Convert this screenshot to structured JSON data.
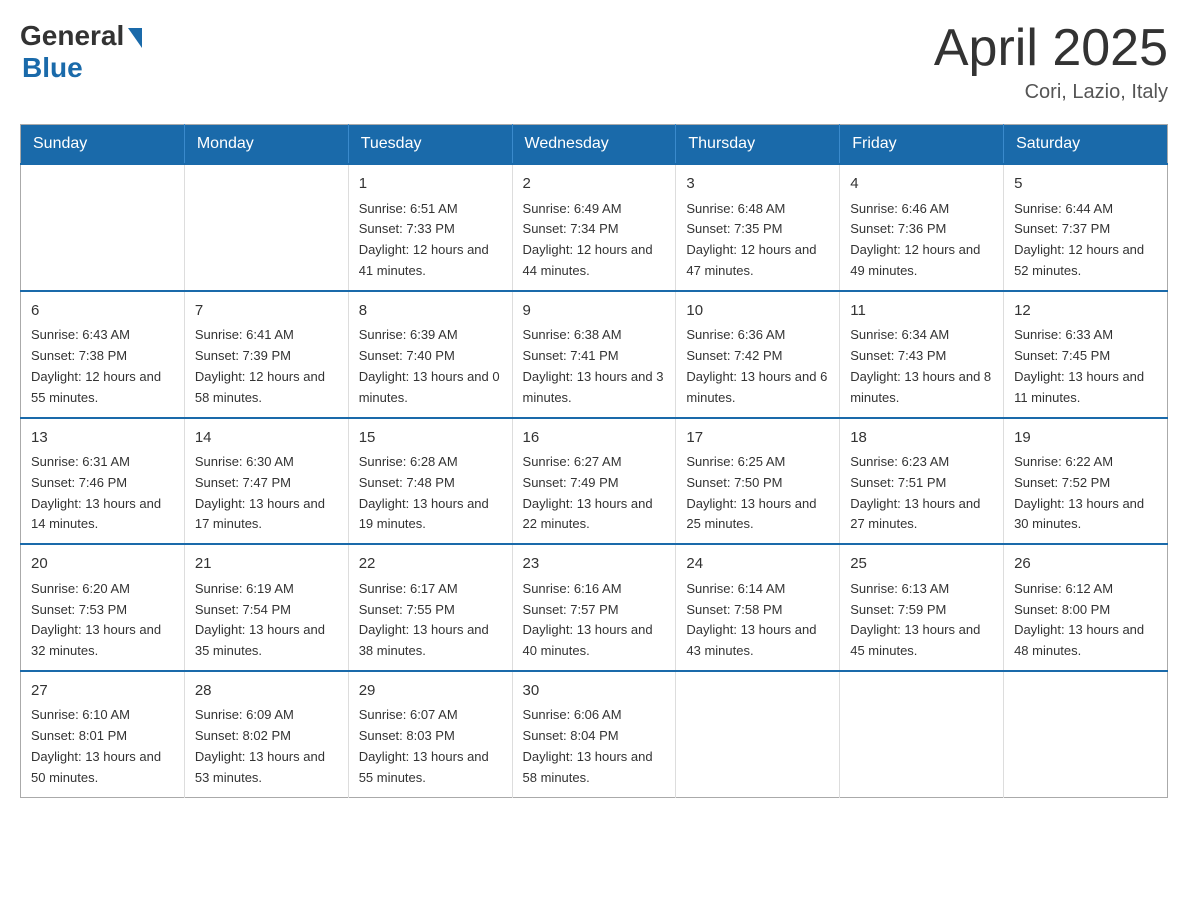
{
  "header": {
    "logo_general": "General",
    "logo_blue": "Blue",
    "month_title": "April 2025",
    "location": "Cori, Lazio, Italy"
  },
  "days_of_week": [
    "Sunday",
    "Monday",
    "Tuesday",
    "Wednesday",
    "Thursday",
    "Friday",
    "Saturday"
  ],
  "weeks": [
    [
      {
        "day": "",
        "sunrise": "",
        "sunset": "",
        "daylight": ""
      },
      {
        "day": "",
        "sunrise": "",
        "sunset": "",
        "daylight": ""
      },
      {
        "day": "1",
        "sunrise": "Sunrise: 6:51 AM",
        "sunset": "Sunset: 7:33 PM",
        "daylight": "Daylight: 12 hours and 41 minutes."
      },
      {
        "day": "2",
        "sunrise": "Sunrise: 6:49 AM",
        "sunset": "Sunset: 7:34 PM",
        "daylight": "Daylight: 12 hours and 44 minutes."
      },
      {
        "day": "3",
        "sunrise": "Sunrise: 6:48 AM",
        "sunset": "Sunset: 7:35 PM",
        "daylight": "Daylight: 12 hours and 47 minutes."
      },
      {
        "day": "4",
        "sunrise": "Sunrise: 6:46 AM",
        "sunset": "Sunset: 7:36 PM",
        "daylight": "Daylight: 12 hours and 49 minutes."
      },
      {
        "day": "5",
        "sunrise": "Sunrise: 6:44 AM",
        "sunset": "Sunset: 7:37 PM",
        "daylight": "Daylight: 12 hours and 52 minutes."
      }
    ],
    [
      {
        "day": "6",
        "sunrise": "Sunrise: 6:43 AM",
        "sunset": "Sunset: 7:38 PM",
        "daylight": "Daylight: 12 hours and 55 minutes."
      },
      {
        "day": "7",
        "sunrise": "Sunrise: 6:41 AM",
        "sunset": "Sunset: 7:39 PM",
        "daylight": "Daylight: 12 hours and 58 minutes."
      },
      {
        "day": "8",
        "sunrise": "Sunrise: 6:39 AM",
        "sunset": "Sunset: 7:40 PM",
        "daylight": "Daylight: 13 hours and 0 minutes."
      },
      {
        "day": "9",
        "sunrise": "Sunrise: 6:38 AM",
        "sunset": "Sunset: 7:41 PM",
        "daylight": "Daylight: 13 hours and 3 minutes."
      },
      {
        "day": "10",
        "sunrise": "Sunrise: 6:36 AM",
        "sunset": "Sunset: 7:42 PM",
        "daylight": "Daylight: 13 hours and 6 minutes."
      },
      {
        "day": "11",
        "sunrise": "Sunrise: 6:34 AM",
        "sunset": "Sunset: 7:43 PM",
        "daylight": "Daylight: 13 hours and 8 minutes."
      },
      {
        "day": "12",
        "sunrise": "Sunrise: 6:33 AM",
        "sunset": "Sunset: 7:45 PM",
        "daylight": "Daylight: 13 hours and 11 minutes."
      }
    ],
    [
      {
        "day": "13",
        "sunrise": "Sunrise: 6:31 AM",
        "sunset": "Sunset: 7:46 PM",
        "daylight": "Daylight: 13 hours and 14 minutes."
      },
      {
        "day": "14",
        "sunrise": "Sunrise: 6:30 AM",
        "sunset": "Sunset: 7:47 PM",
        "daylight": "Daylight: 13 hours and 17 minutes."
      },
      {
        "day": "15",
        "sunrise": "Sunrise: 6:28 AM",
        "sunset": "Sunset: 7:48 PM",
        "daylight": "Daylight: 13 hours and 19 minutes."
      },
      {
        "day": "16",
        "sunrise": "Sunrise: 6:27 AM",
        "sunset": "Sunset: 7:49 PM",
        "daylight": "Daylight: 13 hours and 22 minutes."
      },
      {
        "day": "17",
        "sunrise": "Sunrise: 6:25 AM",
        "sunset": "Sunset: 7:50 PM",
        "daylight": "Daylight: 13 hours and 25 minutes."
      },
      {
        "day": "18",
        "sunrise": "Sunrise: 6:23 AM",
        "sunset": "Sunset: 7:51 PM",
        "daylight": "Daylight: 13 hours and 27 minutes."
      },
      {
        "day": "19",
        "sunrise": "Sunrise: 6:22 AM",
        "sunset": "Sunset: 7:52 PM",
        "daylight": "Daylight: 13 hours and 30 minutes."
      }
    ],
    [
      {
        "day": "20",
        "sunrise": "Sunrise: 6:20 AM",
        "sunset": "Sunset: 7:53 PM",
        "daylight": "Daylight: 13 hours and 32 minutes."
      },
      {
        "day": "21",
        "sunrise": "Sunrise: 6:19 AM",
        "sunset": "Sunset: 7:54 PM",
        "daylight": "Daylight: 13 hours and 35 minutes."
      },
      {
        "day": "22",
        "sunrise": "Sunrise: 6:17 AM",
        "sunset": "Sunset: 7:55 PM",
        "daylight": "Daylight: 13 hours and 38 minutes."
      },
      {
        "day": "23",
        "sunrise": "Sunrise: 6:16 AM",
        "sunset": "Sunset: 7:57 PM",
        "daylight": "Daylight: 13 hours and 40 minutes."
      },
      {
        "day": "24",
        "sunrise": "Sunrise: 6:14 AM",
        "sunset": "Sunset: 7:58 PM",
        "daylight": "Daylight: 13 hours and 43 minutes."
      },
      {
        "day": "25",
        "sunrise": "Sunrise: 6:13 AM",
        "sunset": "Sunset: 7:59 PM",
        "daylight": "Daylight: 13 hours and 45 minutes."
      },
      {
        "day": "26",
        "sunrise": "Sunrise: 6:12 AM",
        "sunset": "Sunset: 8:00 PM",
        "daylight": "Daylight: 13 hours and 48 minutes."
      }
    ],
    [
      {
        "day": "27",
        "sunrise": "Sunrise: 6:10 AM",
        "sunset": "Sunset: 8:01 PM",
        "daylight": "Daylight: 13 hours and 50 minutes."
      },
      {
        "day": "28",
        "sunrise": "Sunrise: 6:09 AM",
        "sunset": "Sunset: 8:02 PM",
        "daylight": "Daylight: 13 hours and 53 minutes."
      },
      {
        "day": "29",
        "sunrise": "Sunrise: 6:07 AM",
        "sunset": "Sunset: 8:03 PM",
        "daylight": "Daylight: 13 hours and 55 minutes."
      },
      {
        "day": "30",
        "sunrise": "Sunrise: 6:06 AM",
        "sunset": "Sunset: 8:04 PM",
        "daylight": "Daylight: 13 hours and 58 minutes."
      },
      {
        "day": "",
        "sunrise": "",
        "sunset": "",
        "daylight": ""
      },
      {
        "day": "",
        "sunrise": "",
        "sunset": "",
        "daylight": ""
      },
      {
        "day": "",
        "sunrise": "",
        "sunset": "",
        "daylight": ""
      }
    ]
  ]
}
